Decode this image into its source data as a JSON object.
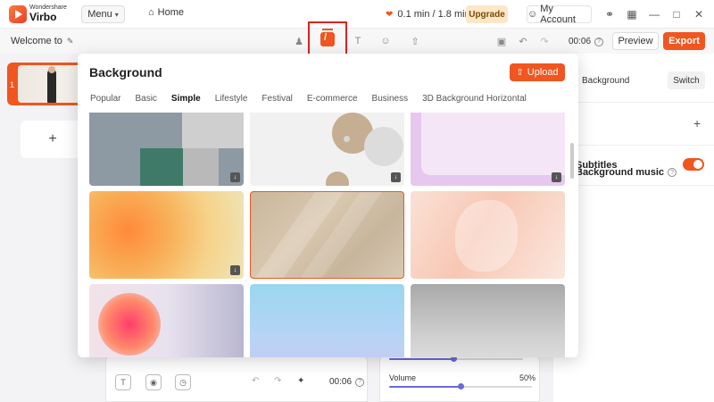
{
  "app": {
    "brand_sub": "Wondershare",
    "brand_main": "Virbo",
    "menu_label": "Menu",
    "home_label": "Home",
    "credits": "0.1 min / 1.8 min",
    "upgrade_label": "Upgrade",
    "account_label": "My Account"
  },
  "toolbar": {
    "project_title": "Welcome to",
    "time": "00:06",
    "preview_label": "Preview",
    "export_label": "Export"
  },
  "scenes": {
    "items": [
      {
        "number": "1"
      }
    ],
    "add_label": "+"
  },
  "background_dialog": {
    "title": "Background",
    "upload_label": "Upload",
    "categories": [
      {
        "label": "Popular",
        "active": false
      },
      {
        "label": "Basic",
        "active": false
      },
      {
        "label": "Simple",
        "active": true
      },
      {
        "label": "Lifestyle",
        "active": false
      },
      {
        "label": "Festival",
        "active": false
      },
      {
        "label": "E-commerce",
        "active": false
      },
      {
        "label": "Business",
        "active": false
      },
      {
        "label": "3D Background Horizontal",
        "active": false
      }
    ],
    "selected_tile": 4
  },
  "right_panel": {
    "background_label": "Background",
    "switch_label": "Switch",
    "music_label": "Background music",
    "subtitles_label": "Subtitles",
    "subtitles_on": true
  },
  "bottom": {
    "time": "00:06",
    "volume_label": "Volume",
    "volume_value": "50%",
    "volume_level": 0.5,
    "speed_level": 0.48
  },
  "colors": {
    "accent": "#f0561f",
    "slider": "#6a6ad8",
    "highlight_box": "#e02020"
  }
}
